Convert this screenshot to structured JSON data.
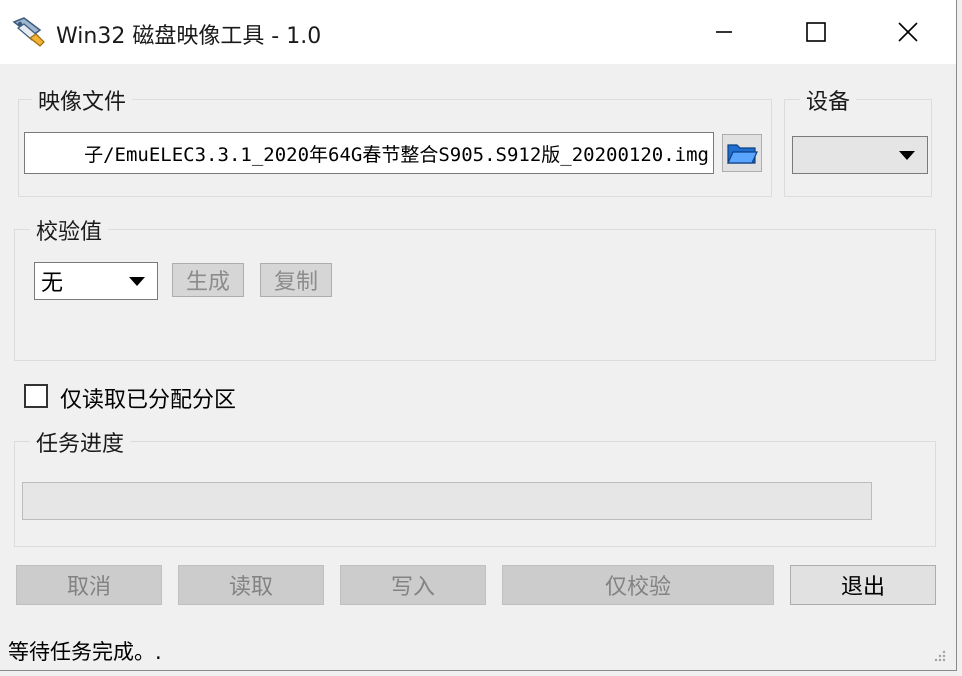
{
  "window": {
    "title": "Win32 磁盘映像工具 - 1.0",
    "minimize_icon": "minimize-icon",
    "maximize_icon": "maximize-icon",
    "close_icon": "close-icon"
  },
  "image_file": {
    "label": "映像文件",
    "path": "子/EmuELEC3.3.1_2020年64G春节整合S905.S912版_20200120.img",
    "browse_icon": "folder-open-icon"
  },
  "device": {
    "label": "设备",
    "selected": ""
  },
  "hash": {
    "label": "校验值",
    "selected": "无",
    "generate_label": "生成",
    "copy_label": "复制"
  },
  "read_only_allocated": {
    "label": "仅读取已分配分区",
    "checked": false
  },
  "progress": {
    "label": "任务进度",
    "value": 0
  },
  "actions": {
    "cancel": "取消",
    "read": "读取",
    "write": "写入",
    "verify_only": "仅校验",
    "exit": "退出"
  },
  "status": {
    "text": "等待任务完成。."
  },
  "colors": {
    "window_bg": "#f0f0f0",
    "titlebar_bg": "#ffffff",
    "disabled_button_bg": "#cccccc",
    "disabled_text": "#838383"
  }
}
